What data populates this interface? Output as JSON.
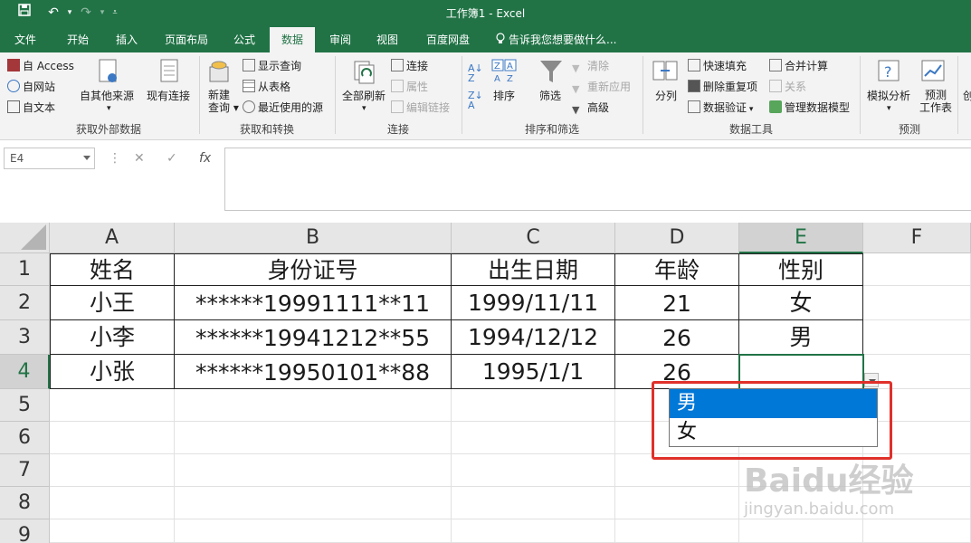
{
  "titlebar": {
    "title": "工作簿1 - Excel",
    "save_icon": "save-icon",
    "undo_icon": "undo-icon",
    "redo_icon": "redo-icon"
  },
  "tabs": [
    {
      "label": "文件"
    },
    {
      "label": "开始"
    },
    {
      "label": "插入"
    },
    {
      "label": "页面布局"
    },
    {
      "label": "公式"
    },
    {
      "label": "数据"
    },
    {
      "label": "审阅"
    },
    {
      "label": "视图"
    },
    {
      "label": "百度网盘"
    },
    {
      "label": "告诉我您想要做什么..."
    }
  ],
  "ribbon": {
    "get_external": {
      "access": "自 Access",
      "web": "自网站",
      "text": "自文本",
      "other": "自其他来源",
      "existing": "现有连接",
      "label": "获取外部数据"
    },
    "transform": {
      "new_query": "新建\n查询",
      "show_query": "显示查询",
      "from_table": "从表格",
      "recent": "最近使用的源",
      "label": "获取和转换"
    },
    "connections": {
      "refresh_all": "全部刷新",
      "connections": "连接",
      "properties": "属性",
      "edit_links": "编辑链接",
      "label": "连接"
    },
    "sort_filter": {
      "sort": "排序",
      "filter": "筛选",
      "clear": "清除",
      "reapply": "重新应用",
      "advanced": "高级",
      "label": "排序和筛选"
    },
    "data_tools": {
      "text_to_columns": "分列",
      "flash_fill": "快速填充",
      "remove_dup": "删除重复项",
      "validation": "数据验证",
      "consolidate": "合并计算",
      "relationships": "关系",
      "manage_model": "管理数据模型",
      "label": "数据工具"
    },
    "forecast": {
      "what_if": "模拟分析",
      "forecast_sheet": "预测\n工作表",
      "label": "预测",
      "cut": "创"
    }
  },
  "formula_bar": {
    "name_box": "E4",
    "cancel": "✕",
    "enter": "✓",
    "fx": "fx",
    "value": ""
  },
  "grid": {
    "columns": [
      "A",
      "B",
      "C",
      "D",
      "E",
      "F"
    ],
    "rows": [
      "1",
      "2",
      "3",
      "4",
      "5",
      "6",
      "7",
      "8",
      "9"
    ],
    "selected_cell": "E4",
    "data": [
      [
        "姓名",
        "身份证号",
        "出生日期",
        "年龄",
        "性别"
      ],
      [
        "小王",
        "******19991111**11",
        "1999/11/11",
        "21",
        "女"
      ],
      [
        "小李",
        "******19941212**55",
        "1994/12/12",
        "26",
        "男"
      ],
      [
        "小张",
        "******19950101**88",
        "1995/1/1",
        "26",
        ""
      ]
    ]
  },
  "dropdown": {
    "options": [
      "男",
      "女"
    ],
    "highlighted": "男"
  },
  "watermark": {
    "logo": "Baidu经验",
    "url": "jingyan.baidu.com"
  },
  "colors": {
    "excel_green": "#217346",
    "highlight": "#0078d7",
    "annotation": "#e0302a"
  }
}
